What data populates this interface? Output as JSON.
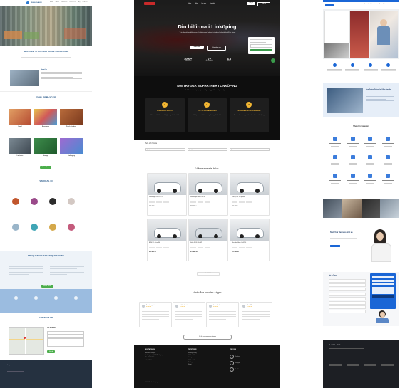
{
  "site1": {
    "brand": "WHOLESALER",
    "nav": [
      "HOME",
      "ABOUT",
      "SERVICES",
      "PRODUCTS",
      "FAQ",
      "CONTACT"
    ],
    "hero_title": "YOUR TRUSTED PARTNER",
    "welcome_title": "WELCOME TO OUR HIGH GRADE WHOLESALER",
    "about_heading": "About Us",
    "services_title": "OUR SERVICES",
    "services": [
      "Food",
      "Beverages",
      "Fresh Produce",
      "Logistics",
      "Storage",
      "Packaging"
    ],
    "more_button": "View More",
    "partners_title": "WE DEAL IN",
    "faq_title": "FREQUENTLY ASKED QUESTIONS",
    "faq_button": "Read More",
    "contact_title": "CONTACT US",
    "contact_form_title": "Get in touch",
    "send_button": "Send",
    "footer_brand": "Logo",
    "accent": "#2a7ad1"
  },
  "site2": {
    "nav": [
      "Hem",
      "Bilar",
      "Om oss",
      "Kontakt"
    ],
    "nav_cta_1": "Sälj bil",
    "nav_cta_2": "Köp bil",
    "hero_title": "Din bilfirma i Linköping",
    "hero_sub": "Vi är din pålitliga bilhandlare i Linköping med ett brett utbud av kvalitetsbilar till bra priser.",
    "hero_btn_primary": "Våra bilar",
    "hero_btn_secondary": "Kontakta oss",
    "stats": [
      {
        "value": "1000+",
        "label": "Nöjda kunder"
      },
      {
        "value": "7+",
        "label": "Års erfarenhet"
      },
      {
        "value": "4.8",
        "label": "Betyg"
      }
    ],
    "trust_title": "DIN TRYGGA BILPARTNER I LINKÖPING",
    "trust_sub": "På Bilhallen i Linköping erbjuder vi dig en trygg bilaffär med personlig service.",
    "trust_cards": [
      {
        "num": "1",
        "title": "PERSONLIG SERVICE",
        "text": "Vi tar oss tid att lyssna och hjälper dig att hitta rätt bil."
      },
      {
        "num": "2",
        "title": "KÖP OCH FINANSIERING",
        "text": "Vi erbjuder flexibla finansieringslösningar för din bil."
      },
      {
        "num": "3",
        "title": "NOGGRANT KONTROLLERAD",
        "text": "Alla våra bilar är noggrant kontrollerade innan försäljning."
      }
    ],
    "filter_title": "Sök och filtrera",
    "filters": [
      "Märke",
      "Modell",
      "Pris"
    ],
    "cars_title": "Våra senaste bilar",
    "cars": [
      {
        "name": "Volkswagen Polo 1.0 TSI",
        "price": "179 900 kr"
      },
      {
        "name": "Volkswagen Golf 1.5 eTSI",
        "price": "229 900 kr"
      },
      {
        "name": "Audi Q3 40 TDI quattro",
        "price": "329 900 kr"
      },
      {
        "name": "BMW X1 sDrive18i",
        "price": "289 900 kr"
      },
      {
        "name": "Volvo XC40 B4 AWD",
        "price": "279 900 kr"
      },
      {
        "name": "Mercedes-Benz GLA 200",
        "price": "319 900 kr"
      }
    ],
    "cars_more": "Visa alla bilar",
    "reviews_title": "Vad våra kunder säger",
    "reviews": [
      {
        "name": "Anna Bergström"
      },
      {
        "name": "Erik Lindqvist"
      },
      {
        "name": "Johan Karlsson"
      },
      {
        "name": "Maria Nilsson"
      }
    ],
    "reviews_button": "Se fler recensioner på Google",
    "footer_cols": [
      "KONTAKTA OSS",
      "ÖPPETTIDER",
      "FÖLJ OSS"
    ],
    "footer_contact": [
      "Bilhallen i Linköping",
      "Industrigatan 12, 582 77 Linköping",
      "Tel: 013-12 34 56",
      "info@bilhallen.se"
    ],
    "footer_hours": [
      "Måndag–Fredag",
      "10:00 – 18:00",
      "Lördag",
      "10:00 – 15:00",
      "Söndag",
      "Stängt"
    ],
    "footer_social": [
      "Facebook",
      "Instagram",
      "YouTube"
    ],
    "footer_copy": "© 2024 Bilhallen i Linköping",
    "accent": "#f2b632"
  },
  "site3": {
    "nav": [
      "Home",
      "Products",
      "Services",
      "About",
      "Contact"
    ],
    "section_title": "Shop By Category",
    "promo_title": "Your Trusted Partner for Office Supplies",
    "cta_title": "Start Your Business with us",
    "form_title": "Get In Touch",
    "footer_title": "Visit Office Online",
    "accent": "#1a66d6"
  }
}
